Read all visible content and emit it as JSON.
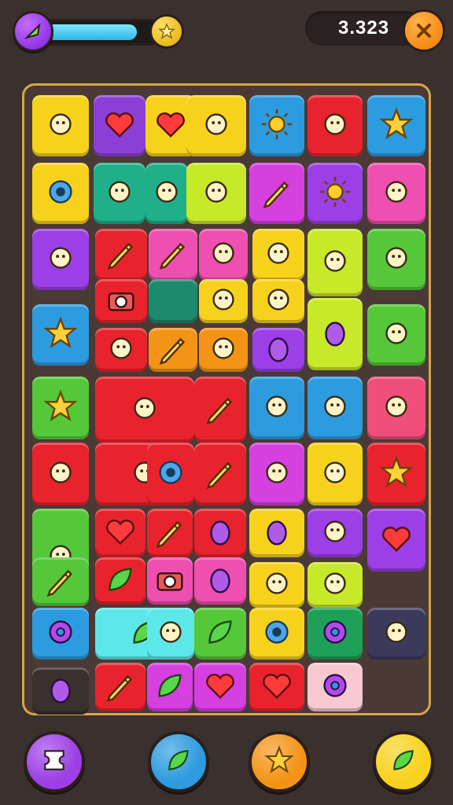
{
  "hud": {
    "level_icon": "leaf-icon",
    "progress_fraction": 0.86,
    "progress_end_icon": "star-icon",
    "score": "3.323",
    "close_icon": "close-icon"
  },
  "board": {
    "tiles": [
      {
        "icon": "crossed-bird-icon",
        "color": "#f7d21c"
      },
      {
        "icon": "heart-icon",
        "color": "#8b3fd6"
      },
      {
        "icon": "heart-icon",
        "color": "#f7d21c"
      },
      {
        "icon": "shell-icon",
        "color": "#f7d21c"
      },
      {
        "icon": "sun-icon",
        "color": "#2d9be0"
      },
      {
        "icon": "cloud-icon",
        "color": "#e8232e"
      },
      {
        "icon": "star-icon",
        "color": "#2d9be0"
      },
      {
        "icon": "gear-icon",
        "color": "#f7d21c"
      },
      {
        "icon": "acorn-icon",
        "color": "#1fb08a"
      },
      {
        "icon": "gift-box-icon",
        "color": "#1fb08a"
      },
      {
        "icon": "turtle-icon",
        "color": "#c8e82a"
      },
      {
        "icon": "pencil-icon",
        "color": "#d63fe0"
      },
      {
        "icon": "sun-face-icon",
        "color": "#9c3fe6"
      },
      {
        "icon": "potato-icon",
        "color": "#ef4fb0"
      },
      {
        "icon": "robot-icon",
        "color": "#9c3fe6"
      },
      {
        "icon": "pencil-icon",
        "color": "#e8232e"
      },
      {
        "icon": "pencil-icon",
        "color": "#ef4fb0"
      },
      {
        "icon": "stairs-icon",
        "color": "#ef4fb0"
      },
      {
        "icon": "diamond-icon",
        "color": "#f7d21c"
      },
      {
        "icon": "mushroom-icon",
        "color": "#c8e82a"
      },
      {
        "icon": "apple-icon",
        "color": "#55c83a"
      },
      {
        "icon": "camera-icon",
        "color": "#e8232e"
      },
      {
        "icon": "blank-icon",
        "color": "#1c8a6c"
      },
      {
        "icon": "spiky-ball-icon",
        "color": "#f7d21c"
      },
      {
        "icon": "eraser-icon",
        "color": "#f7d21c"
      },
      {
        "icon": "balloon-icon",
        "color": "#c8e82a"
      },
      {
        "icon": "star-icon",
        "color": "#2d9be0"
      },
      {
        "icon": "seashell-icon",
        "color": "#55c83a"
      },
      {
        "icon": "bread-icon",
        "color": "#e8232e"
      },
      {
        "icon": "pencil-icon",
        "color": "#f39416"
      },
      {
        "icon": "ufo-icon",
        "color": "#f39416"
      },
      {
        "icon": "grape-icon",
        "color": "#9c3fe6"
      },
      {
        "icon": "star-icon",
        "color": "#55c83a"
      },
      {
        "icon": "muffin-icon",
        "color": "#e8232e"
      },
      {
        "icon": "pencil-icon",
        "color": "#e8232e"
      },
      {
        "icon": "key-icon",
        "color": "#2d9be0"
      },
      {
        "icon": "chef-hat-icon",
        "color": "#2d9be0"
      },
      {
        "icon": "treasure-chest-icon",
        "color": "#ef4f7a"
      },
      {
        "icon": "starfish-icon",
        "color": "#e8232e"
      },
      {
        "icon": "jelly-icon",
        "color": "#e8232e"
      },
      {
        "icon": "wheel-icon",
        "color": "#e8232e"
      },
      {
        "icon": "pencil-icon",
        "color": "#e8232e"
      },
      {
        "icon": "ghost-icon",
        "color": "#d63fe0"
      },
      {
        "icon": "pyramid-icon",
        "color": "#f7d21c"
      },
      {
        "icon": "star-icon",
        "color": "#e8232e"
      },
      {
        "icon": "flower-icon",
        "color": "#55c83a"
      },
      {
        "icon": "heart-icon",
        "color": "#e8232e"
      },
      {
        "icon": "pencil-icon",
        "color": "#e8232e"
      },
      {
        "icon": "egg-icon",
        "color": "#e8232e"
      },
      {
        "icon": "egg-icon",
        "color": "#f7d21c"
      },
      {
        "icon": "spiky-face-icon",
        "color": "#9c3fe6"
      },
      {
        "icon": "heart-icon",
        "color": "#9c3fe6"
      },
      {
        "icon": "pipette-icon",
        "color": "#55c83a"
      },
      {
        "icon": "leaf-icon",
        "color": "#e8232e"
      },
      {
        "icon": "camera-icon",
        "color": "#ef4fb0"
      },
      {
        "icon": "egg-icon",
        "color": "#ef4fb0"
      },
      {
        "icon": "gem-icon",
        "color": "#f7d21c"
      },
      {
        "icon": "candy-icon",
        "color": "#c8e82a"
      },
      {
        "icon": "donut-icon",
        "color": "#2d9be0"
      },
      {
        "icon": "feather-icon",
        "color": "#5ce8e8"
      },
      {
        "icon": "lemon-icon",
        "color": "#5ce8e8"
      },
      {
        "icon": "leaf-icon",
        "color": "#55c83a"
      },
      {
        "icon": "timer-icon",
        "color": "#f7d21c"
      },
      {
        "icon": "ring-icon",
        "color": "#1fa058"
      },
      {
        "icon": "note-icon",
        "color": "#3c3a5a"
      },
      {
        "icon": "egg-icon",
        "color": "#3a302e"
      },
      {
        "icon": "carrot-icon",
        "color": "#e8232e"
      },
      {
        "icon": "leaf-icon",
        "color": "#d63fe0"
      },
      {
        "icon": "heart-icon",
        "color": "#d63fe0"
      },
      {
        "icon": "heart-icon",
        "color": "#e8232e"
      },
      {
        "icon": "cookie-icon",
        "color": "#f7c8d0"
      }
    ]
  },
  "bottom": {
    "buttons": [
      {
        "icon": "ticket-icon",
        "color": "#9c3fe6"
      },
      {
        "icon": "leaf-icon",
        "color": "#2d9be0"
      },
      {
        "icon": "star-icon",
        "color": "#f39416"
      },
      {
        "icon": "leaf-icon",
        "color": "#f7d21c"
      }
    ]
  }
}
